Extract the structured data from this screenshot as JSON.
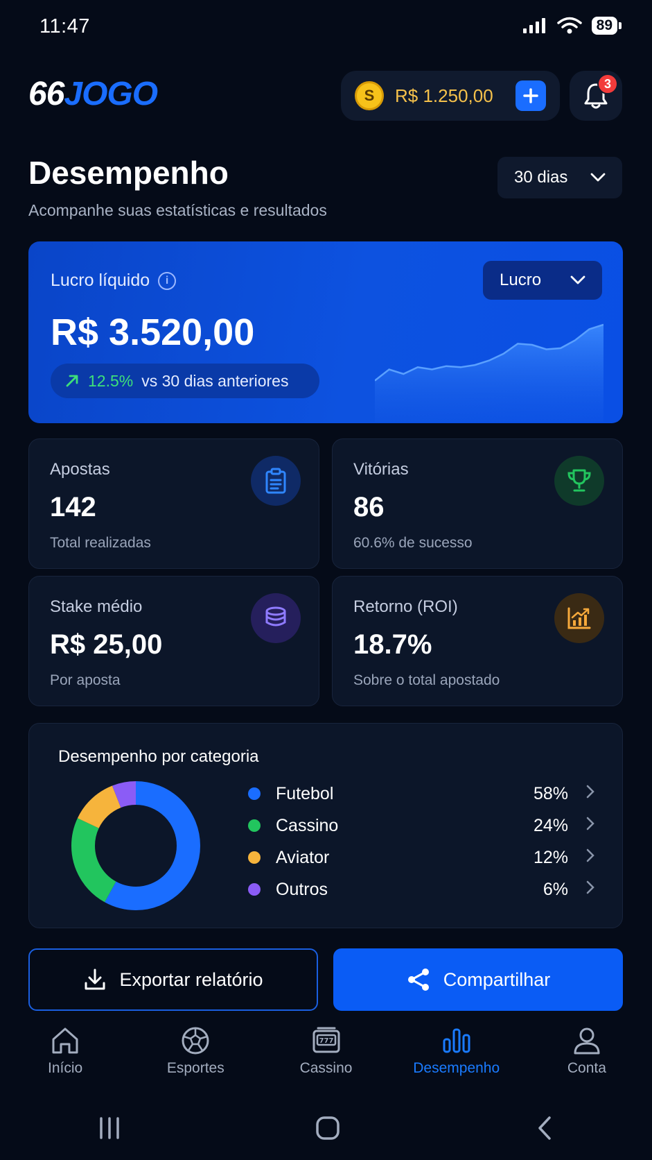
{
  "status_bar": {
    "time": "11:47",
    "battery": "89"
  },
  "header": {
    "logo_part1": "66",
    "logo_part2": "JOGO",
    "coin_symbol": "S",
    "balance": "R$ 1.250,00",
    "notifications_count": "3"
  },
  "page": {
    "title": "Desempenho",
    "subtitle": "Acompanhe suas estatísticas e resultados",
    "period": "30 dias"
  },
  "profit_card": {
    "label": "Lucro líquido",
    "value": "R$ 3.520,00",
    "trend_pct": "12.5%",
    "trend_text": "vs 30 dias anteriores",
    "metric": "Lucro",
    "sparkline": [
      12,
      22,
      18,
      24,
      22,
      25,
      24,
      26,
      30,
      36,
      45,
      44,
      40,
      41,
      48,
      58,
      62
    ]
  },
  "stats": [
    {
      "label": "Apostas",
      "value": "142",
      "sub": "Total realizadas",
      "icon": "clipboard-icon"
    },
    {
      "label": "Vitórias",
      "value": "86",
      "sub": "60.6% de sucesso",
      "icon": "trophy-icon"
    },
    {
      "label": "Stake médio",
      "value": "R$ 25,00",
      "sub": "Por aposta",
      "icon": "coins-stack-icon"
    },
    {
      "label": "Retorno (ROI)",
      "value": "18.7%",
      "sub": "Sobre o total apostado",
      "icon": "chart-up-icon"
    }
  ],
  "categories": {
    "title": "Desempenho por categoria",
    "items": [
      {
        "name": "Futebol",
        "pct": "58%",
        "value": 58,
        "color": "#1a6dff"
      },
      {
        "name": "Cassino",
        "pct": "24%",
        "value": 24,
        "color": "#22c55e"
      },
      {
        "name": "Aviator",
        "pct": "12%",
        "value": 12,
        "color": "#f6b43c"
      },
      {
        "name": "Outros",
        "pct": "6%",
        "value": 6,
        "color": "#8b5cf6"
      }
    ]
  },
  "actions": {
    "export": "Exportar relatório",
    "share": "Compartilhar"
  },
  "nav": [
    {
      "label": "Início",
      "icon": "home-icon"
    },
    {
      "label": "Esportes",
      "icon": "soccer-ball-icon"
    },
    {
      "label": "Cassino",
      "icon": "slot-machine-icon"
    },
    {
      "label": "Desempenho",
      "icon": "bar-chart-icon"
    },
    {
      "label": "Conta",
      "icon": "user-icon"
    }
  ],
  "colors": {
    "accent": "#1a6dff",
    "positive": "#3ee07a",
    "gold": "#f5c14b",
    "danger": "#f23b3b"
  }
}
